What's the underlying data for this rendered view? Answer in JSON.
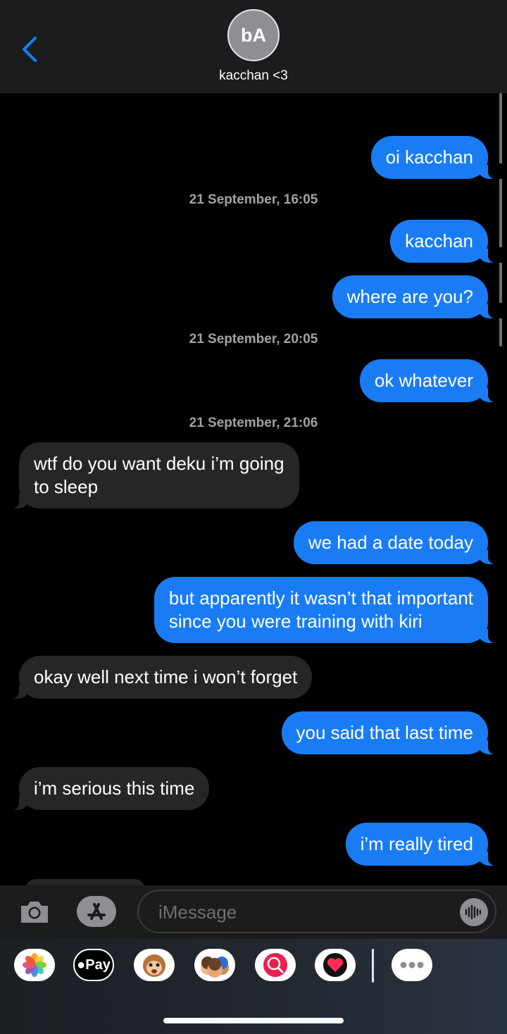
{
  "header": {
    "avatar_initials": "bA",
    "contact_name": "kacchan <3"
  },
  "thread": {
    "messages": [
      {
        "kind": "sent",
        "text": "oi kacchan"
      },
      {
        "kind": "timestamp",
        "text": "21 September, 16:05"
      },
      {
        "kind": "sent",
        "text": "kacchan"
      },
      {
        "kind": "sent",
        "text": "where are you?"
      },
      {
        "kind": "timestamp",
        "text": "21 September, 20:05"
      },
      {
        "kind": "sent",
        "text": "ok whatever"
      },
      {
        "kind": "timestamp",
        "text": "21 September, 21:06"
      },
      {
        "kind": "received",
        "text": "wtf do you want deku i’m going",
        "text2": "to sleep"
      },
      {
        "kind": "sent",
        "text": "we had a date today"
      },
      {
        "kind": "sent",
        "text": "but apparently it wasn’t that important",
        "text2": "since you were training with kiri"
      },
      {
        "kind": "received",
        "text": "okay well next time i won’t forget"
      },
      {
        "kind": "sent",
        "text": "you said that last time"
      },
      {
        "kind": "received",
        "text": "i’m serious this time"
      },
      {
        "kind": "sent",
        "text": "i’m really tired"
      }
    ]
  },
  "input": {
    "placeholder": "iMessage"
  },
  "apps": {
    "items": [
      {
        "name": "photos-app-icon"
      },
      {
        "name": "apple-pay-icon",
        "label": "Pay"
      },
      {
        "name": "animoji-icon"
      },
      {
        "name": "memoji-icon"
      },
      {
        "name": "web-images-search-icon"
      },
      {
        "name": "digital-touch-icon"
      },
      {
        "name": "more-apps-icon"
      }
    ]
  },
  "colors": {
    "sent_bubble": "#1a7cf5",
    "received_bubble": "#262628",
    "accent": "#0a84ff"
  }
}
